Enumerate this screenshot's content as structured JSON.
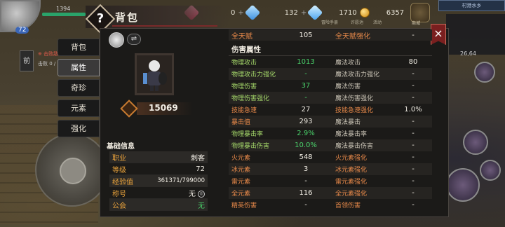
{
  "hud": {
    "hp_value": "1394",
    "level": "72",
    "side_label": "前",
    "kill_line_1": "※ 击败敌",
    "kill_line_2": "击败 0 /"
  },
  "topbar": {
    "pink_gem_value": "",
    "blue_gem_value": "0",
    "diamond_value": "132",
    "gold_value": "1710",
    "coin_value": "6357",
    "sub_1": "冒险手册",
    "sub_2": "许愿池",
    "sub_3": "活动",
    "shop_label": "商城",
    "map_name": "村港水乡",
    "minimap_num": "26,64"
  },
  "header": {
    "badge": "?",
    "title": "背包"
  },
  "tabs": [
    "背包",
    "属性",
    "奇珍",
    "元素",
    "强化"
  ],
  "active_tab": 1,
  "close_label": "×",
  "character": {
    "swap_label": "⇌",
    "power": "15069"
  },
  "basic": {
    "title": "基础信息",
    "rows": [
      {
        "k": "职业",
        "v": "刺客"
      },
      {
        "k": "等级",
        "v": "72"
      },
      {
        "k": "经验值",
        "v": "361371/799000"
      },
      {
        "k": "称号",
        "v": "无"
      },
      {
        "k": "公会",
        "v": "无"
      }
    ],
    "title_info": "◎"
  },
  "stats": {
    "top_row": {
      "k1": "全天赋",
      "v1": "105",
      "k2": "全天赋强化",
      "v2": "-"
    },
    "section_title": "伤害属性",
    "rows": [
      {
        "k1": "物理攻击",
        "v1": "1013",
        "k2": "魔法攻击",
        "v2": "80"
      },
      {
        "k1": "物理攻击力强化",
        "v1": "-",
        "k2": "魔法攻击力强化",
        "v2": "-"
      },
      {
        "k1": "物理伤害",
        "v1": "37",
        "k2": "魔法伤害",
        "v2": "-"
      },
      {
        "k1": "物理伤害强化",
        "v1": "-",
        "k2": "魔法伤害强化",
        "v2": "-"
      },
      {
        "k1": "技能急速",
        "v1": "27",
        "k2": "技能急速强化",
        "v2": "1.0%"
      },
      {
        "k1": "暴击值",
        "v1": "293",
        "k2": "魔法暴击",
        "v2": "-"
      },
      {
        "k1": "物理暴击率",
        "v1": "2.9%",
        "k2": "魔法暴击率",
        "v2": "-"
      },
      {
        "k1": "物理暴击伤害",
        "v1": "10.0%",
        "k2": "魔法暴击伤害",
        "v2": "-"
      },
      {
        "k1": "火元素",
        "v1": "548",
        "k2": "火元素强化",
        "v2": "-"
      },
      {
        "k1": "冰元素",
        "v1": "3",
        "k2": "冰元素强化",
        "v2": "-"
      },
      {
        "k1": "雷元素",
        "v1": "-",
        "k2": "雷元素强化",
        "v2": "-"
      },
      {
        "k1": "全元素",
        "v1": "116",
        "k2": "全元素强化",
        "v2": "-"
      },
      {
        "k1": "精英伤害",
        "v1": "-",
        "k2": "首领伤害",
        "v2": "-"
      }
    ]
  },
  "colors": {
    "accent_orange": "#e9a23b",
    "value_green": "#4ad06a",
    "label_green": "#a5d86a",
    "close_red": "#7a1f1f"
  }
}
